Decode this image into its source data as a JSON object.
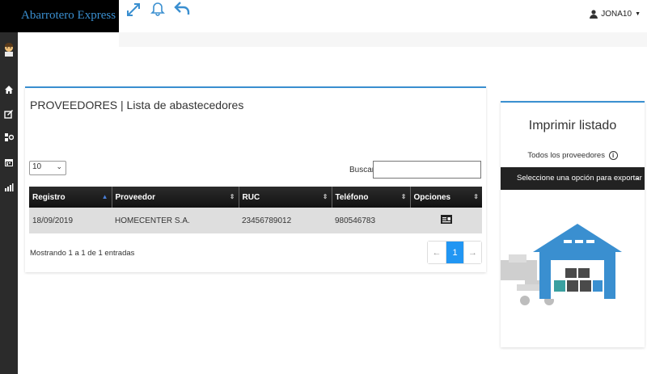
{
  "app": {
    "brand": "Abarrotero Express",
    "user": "JONA10"
  },
  "icons": [
    "expand-icon",
    "bell-icon",
    "reply-icon",
    "user-icon",
    "home-icon",
    "edit-icon",
    "settings-icon",
    "calendar-icon",
    "chart-icon",
    "invoice-icon",
    "info-icon"
  ],
  "colors": {
    "accent": "#3a8fd0",
    "header": "#111111",
    "active_page": "#2196f3",
    "warehouse_blue": "#3a8fd0",
    "box_dark": "#4a4a4a",
    "box_teal": "#3aa0a0"
  },
  "main": {
    "title": "PROVEEDORES | Lista de abastecedores",
    "page_length": "10",
    "search_label": "Buscar:",
    "search_value": "",
    "table": {
      "columns": [
        "Registro",
        "Proveedor",
        "RUC",
        "Teléfono",
        "Opciones"
      ],
      "rows": [
        {
          "registro": "18/09/2019",
          "proveedor": "HOMECENTER S.A.",
          "ruc": "23456789012",
          "telefono": "980546783",
          "opciones": "invoice-icon"
        }
      ]
    },
    "info": "Mostrando 1 a 1 de 1 entradas",
    "pagination": {
      "prev": "←",
      "current": "1",
      "next": "→"
    }
  },
  "right": {
    "title": "Imprimir listado",
    "subtitle": "Todos los proveedores",
    "export_label": "Seleccione una opción para exportar"
  }
}
